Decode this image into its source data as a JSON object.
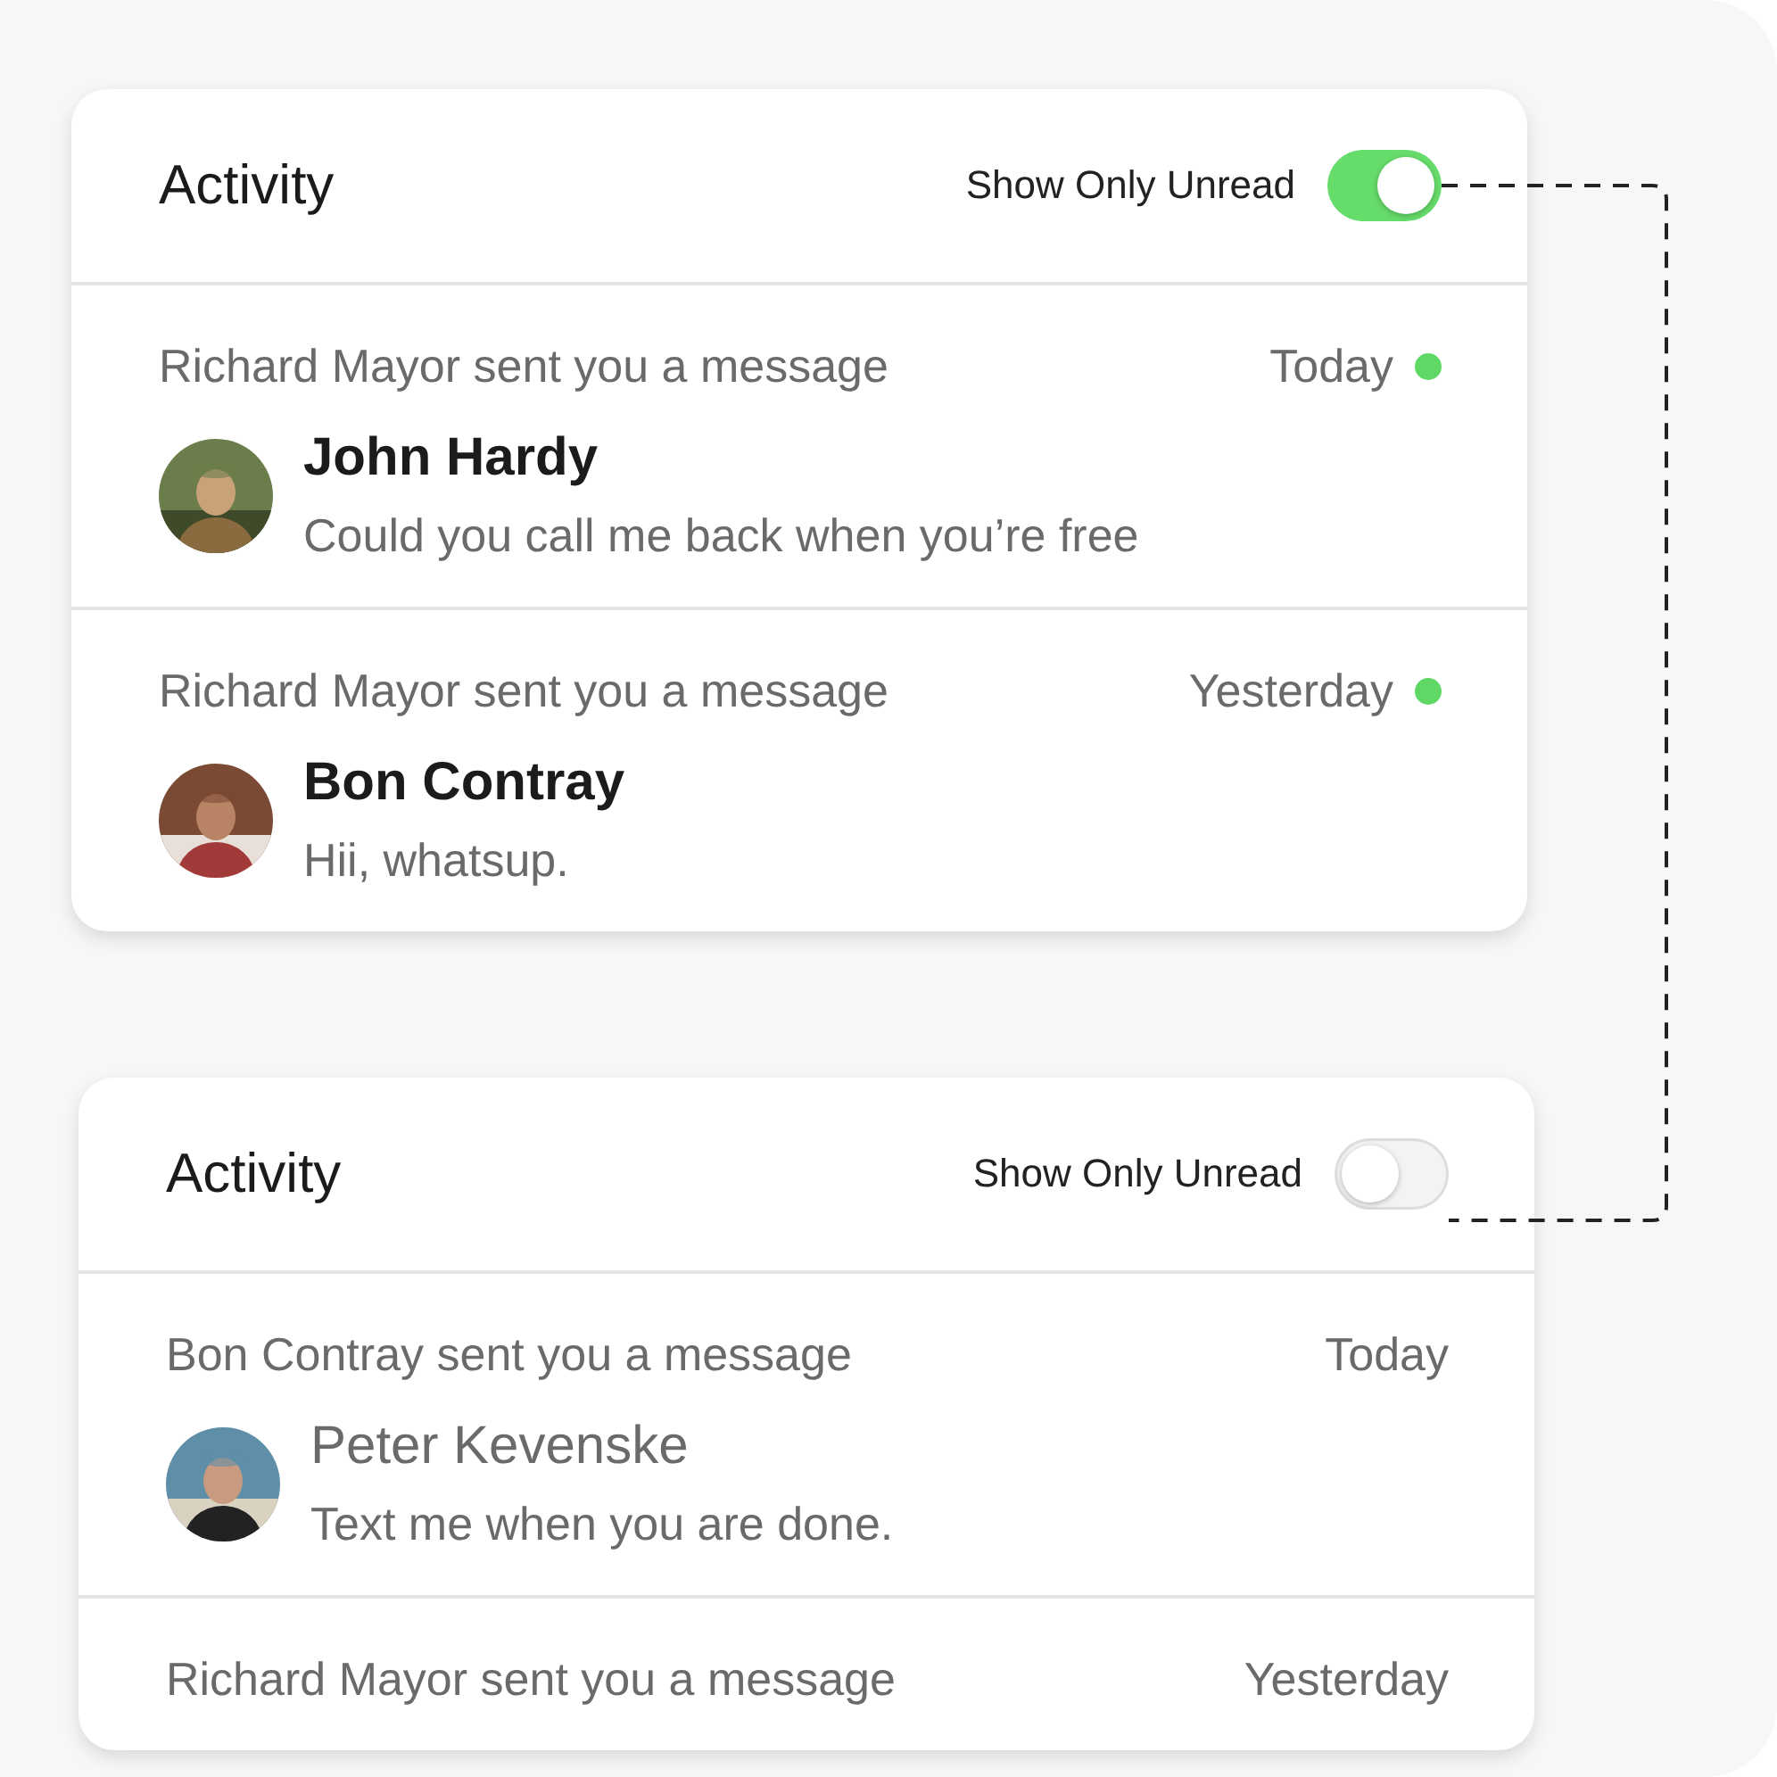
{
  "panels": [
    {
      "title": "Activity",
      "filter": {
        "label": "Show Only Unread",
        "on": true
      },
      "notifications": [
        {
          "summary": "Richard Mayor sent you a message",
          "time": "Today",
          "unread": true,
          "sender": "John Hardy",
          "message": "Could you call me back when you’re free"
        },
        {
          "summary": "Richard Mayor sent you a message",
          "time": "Yesterday",
          "unread": true,
          "sender": "Bon Contray",
          "message": "Hii, whatsup."
        }
      ]
    },
    {
      "title": "Activity",
      "filter": {
        "label": "Show Only Unread",
        "on": false
      },
      "notifications": [
        {
          "summary": "Bon Contray sent you a message",
          "time": "Today",
          "unread": false,
          "sender": "Peter Kevenske",
          "message": "Text me when you are done."
        },
        {
          "summary": "Richard Mayor sent you a message",
          "time": "Yesterday",
          "unread": false
        }
      ]
    }
  ]
}
